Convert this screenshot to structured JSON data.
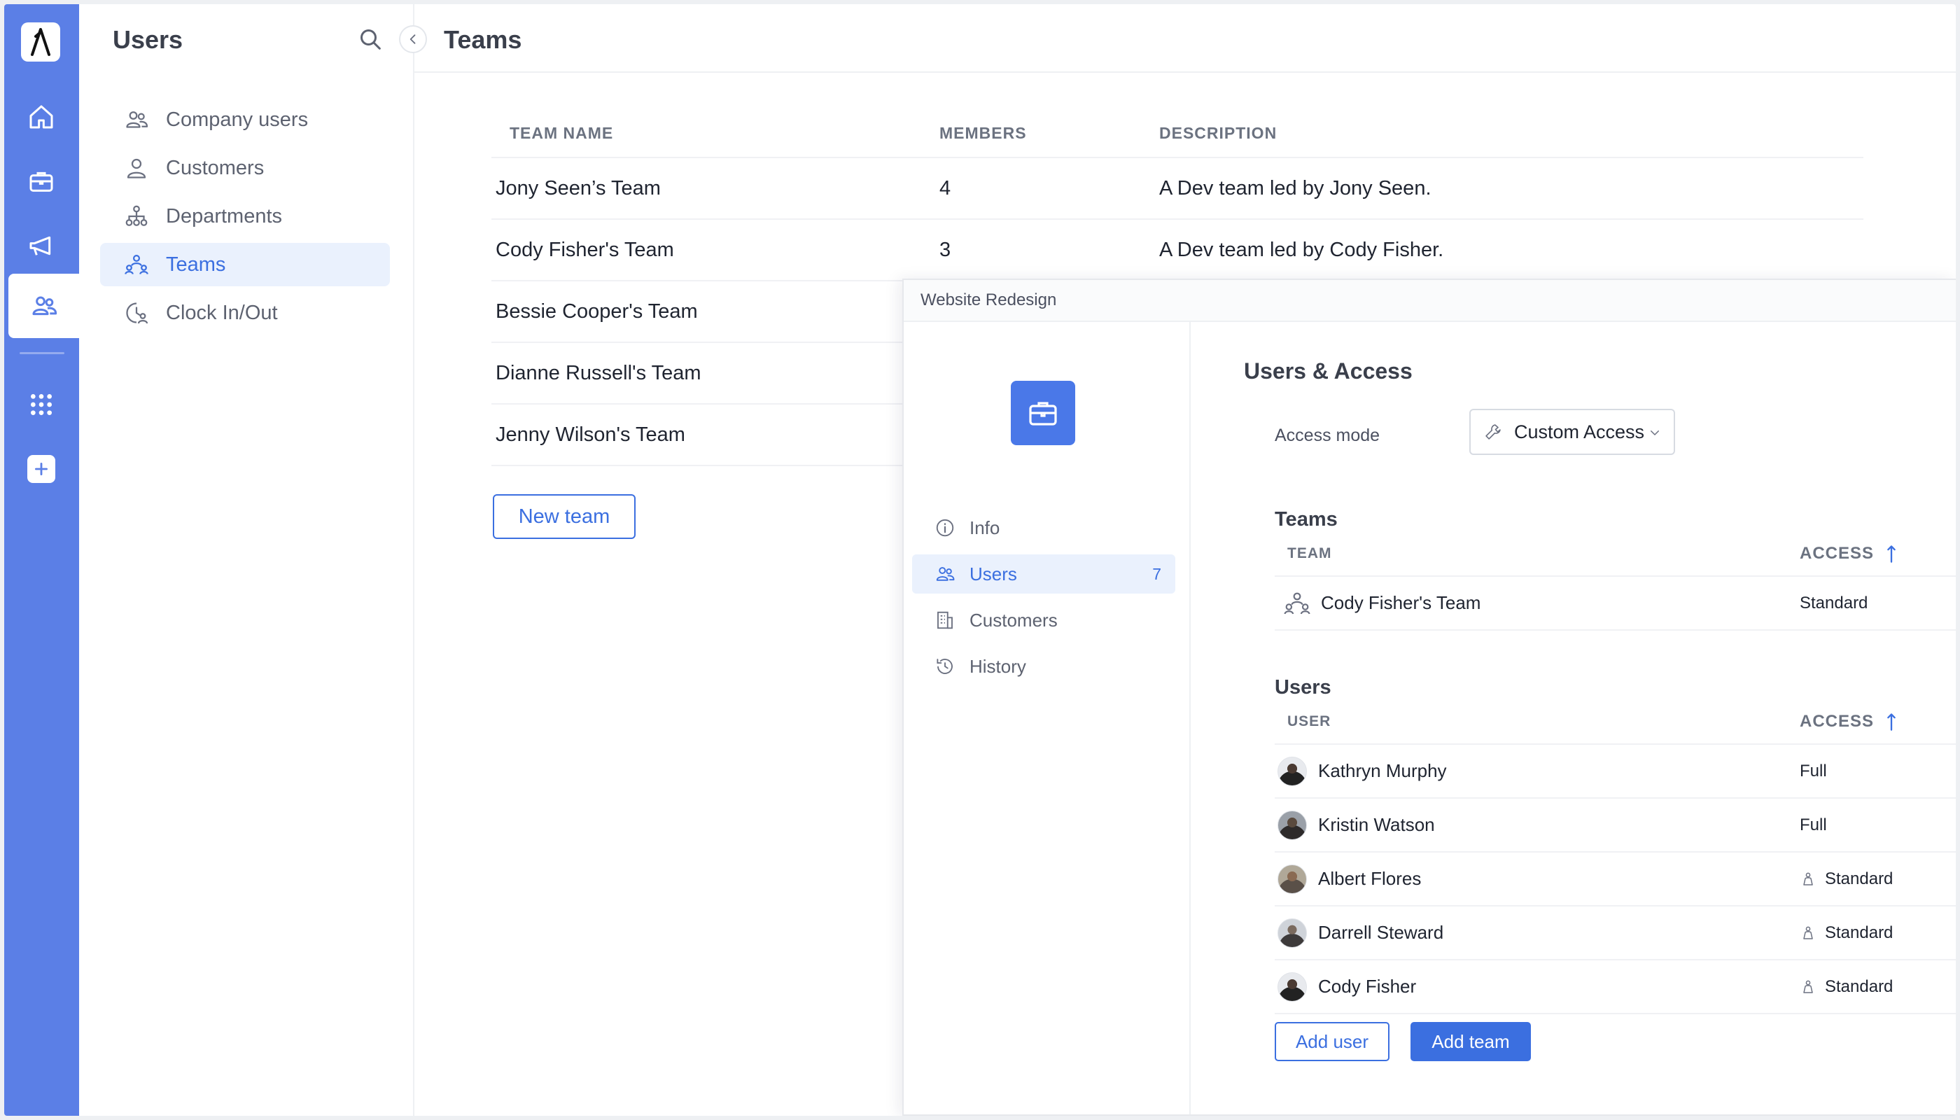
{
  "sidebar": {
    "title": "Users",
    "items": [
      {
        "label": "Company users"
      },
      {
        "label": "Customers"
      },
      {
        "label": "Departments"
      },
      {
        "label": "Teams"
      },
      {
        "label": "Clock In/Out"
      }
    ]
  },
  "main": {
    "title": "Teams",
    "columns": {
      "name": "TEAM NAME",
      "members": "MEMBERS",
      "description": "DESCRIPTION"
    },
    "rows": [
      {
        "name": "Jony Seen’s Team",
        "members": "4",
        "description": "A Dev team led by Jony Seen."
      },
      {
        "name": "Cody Fisher's Team",
        "members": "3",
        "description": "A Dev team led by Cody Fisher."
      },
      {
        "name": "Bessie Cooper's Team",
        "members": "",
        "description": ""
      },
      {
        "name": "Dianne Russell's Team",
        "members": "",
        "description": ""
      },
      {
        "name": "Jenny Wilson's Team",
        "members": "",
        "description": ""
      }
    ],
    "new_team_label": "New team"
  },
  "panel": {
    "header": "Website Redesign",
    "nav": [
      {
        "label": "Info"
      },
      {
        "label": "Users",
        "count": "7"
      },
      {
        "label": "Customers"
      },
      {
        "label": "History"
      }
    ],
    "title": "Users & Access",
    "access_mode_label": "Access mode",
    "access_mode_value": "Custom Access",
    "teams": {
      "title": "Teams",
      "col_team": "TEAM",
      "col_access": "ACCESS",
      "rows": [
        {
          "name": "Cody Fisher's Team",
          "access": "Standard"
        }
      ]
    },
    "users": {
      "title": "Users",
      "col_user": "USER",
      "col_access": "ACCESS",
      "rows": [
        {
          "name": "Kathryn Murphy",
          "access": "Full"
        },
        {
          "name": "Kristin Watson",
          "access": "Full"
        },
        {
          "name": "Albert Flores",
          "access": "Standard"
        },
        {
          "name": "Darrell Steward",
          "access": "Standard"
        },
        {
          "name": "Cody Fisher",
          "access": "Standard"
        }
      ]
    },
    "add_user_label": "Add user",
    "add_team_label": "Add team"
  },
  "colors": {
    "rail": "#5b7fe6",
    "accent": "#3b6fe0",
    "active_bg": "#eaf1fd"
  }
}
